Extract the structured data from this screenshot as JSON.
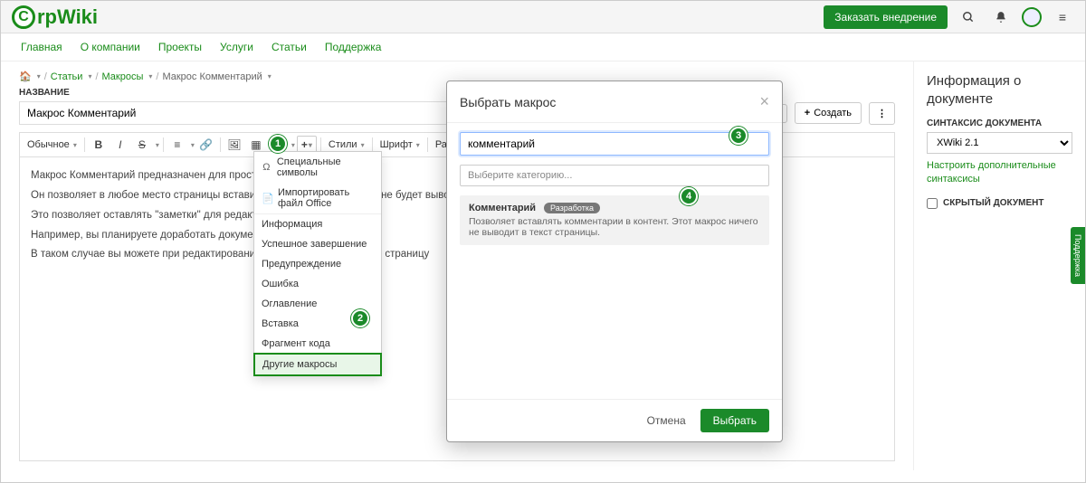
{
  "header": {
    "logo_text": "rpWiki",
    "logo_c": "C",
    "cta": "Заказать внедрение"
  },
  "nav": {
    "items": [
      "Главная",
      "О компании",
      "Проекты",
      "Услуги",
      "Статьи",
      "Поддержка"
    ]
  },
  "breadcrumb": {
    "items": [
      "Статьи",
      "Макросы",
      "Макрос Комментарий"
    ]
  },
  "editor": {
    "title_label": "НАЗВАНИЕ",
    "title_value": "Макрос Комментарий",
    "create_btn": "Создать",
    "toolbar": {
      "format": "Обычное",
      "styles": "Стили",
      "font": "Шрифт",
      "size": "Размер"
    },
    "body_lines": [
      "Макрос Комментарий предназначен для  простого, но очень важного.",
      "Он позволяет в любое место страницы вставить комментарий, который не будет выводиться в режиме",
      "Это позволяет оставлять \"заметки\" для редакторов документа.",
      "Например, вы планируете доработать документ в дальнейшем.",
      "В таком случае вы можете при редактировании вставить комментарий в страницу"
    ]
  },
  "dropdown": {
    "items": [
      {
        "icon": "Ω",
        "label": "Специальные символы"
      },
      {
        "icon": "📄",
        "label": "Импортировать файл Office"
      }
    ],
    "items2": [
      "Информация",
      "Успешное завершение",
      "Предупреждение",
      "Ошибка",
      "Оглавление",
      "Вставка",
      "Фрагмент кода"
    ],
    "last": "Другие макросы"
  },
  "modal": {
    "title": "Выбрать макрос",
    "search_value": "комментарий",
    "category_placeholder": "Выберите категорию...",
    "card": {
      "title": "Комментарий",
      "tag": "Разработка",
      "desc": "Позволяет вставлять комментарии в контент. Этот макрос ничего не выводит в текст страницы."
    },
    "cancel": "Отмена",
    "select": "Выбрать"
  },
  "sidebar": {
    "heading": "Информация о документе",
    "syntax_label": "СИНТАКСИС ДОКУМЕНТА",
    "syntax_value": "XWiki 2.1",
    "config_link": "Настроить дополнительные синтаксисы",
    "hidden_label": "СКРЫТЫЙ ДОКУМЕНТ"
  },
  "support_tab": "Поддержка",
  "badges": {
    "b1": "1",
    "b2": "2",
    "b3": "3",
    "b4": "4"
  }
}
